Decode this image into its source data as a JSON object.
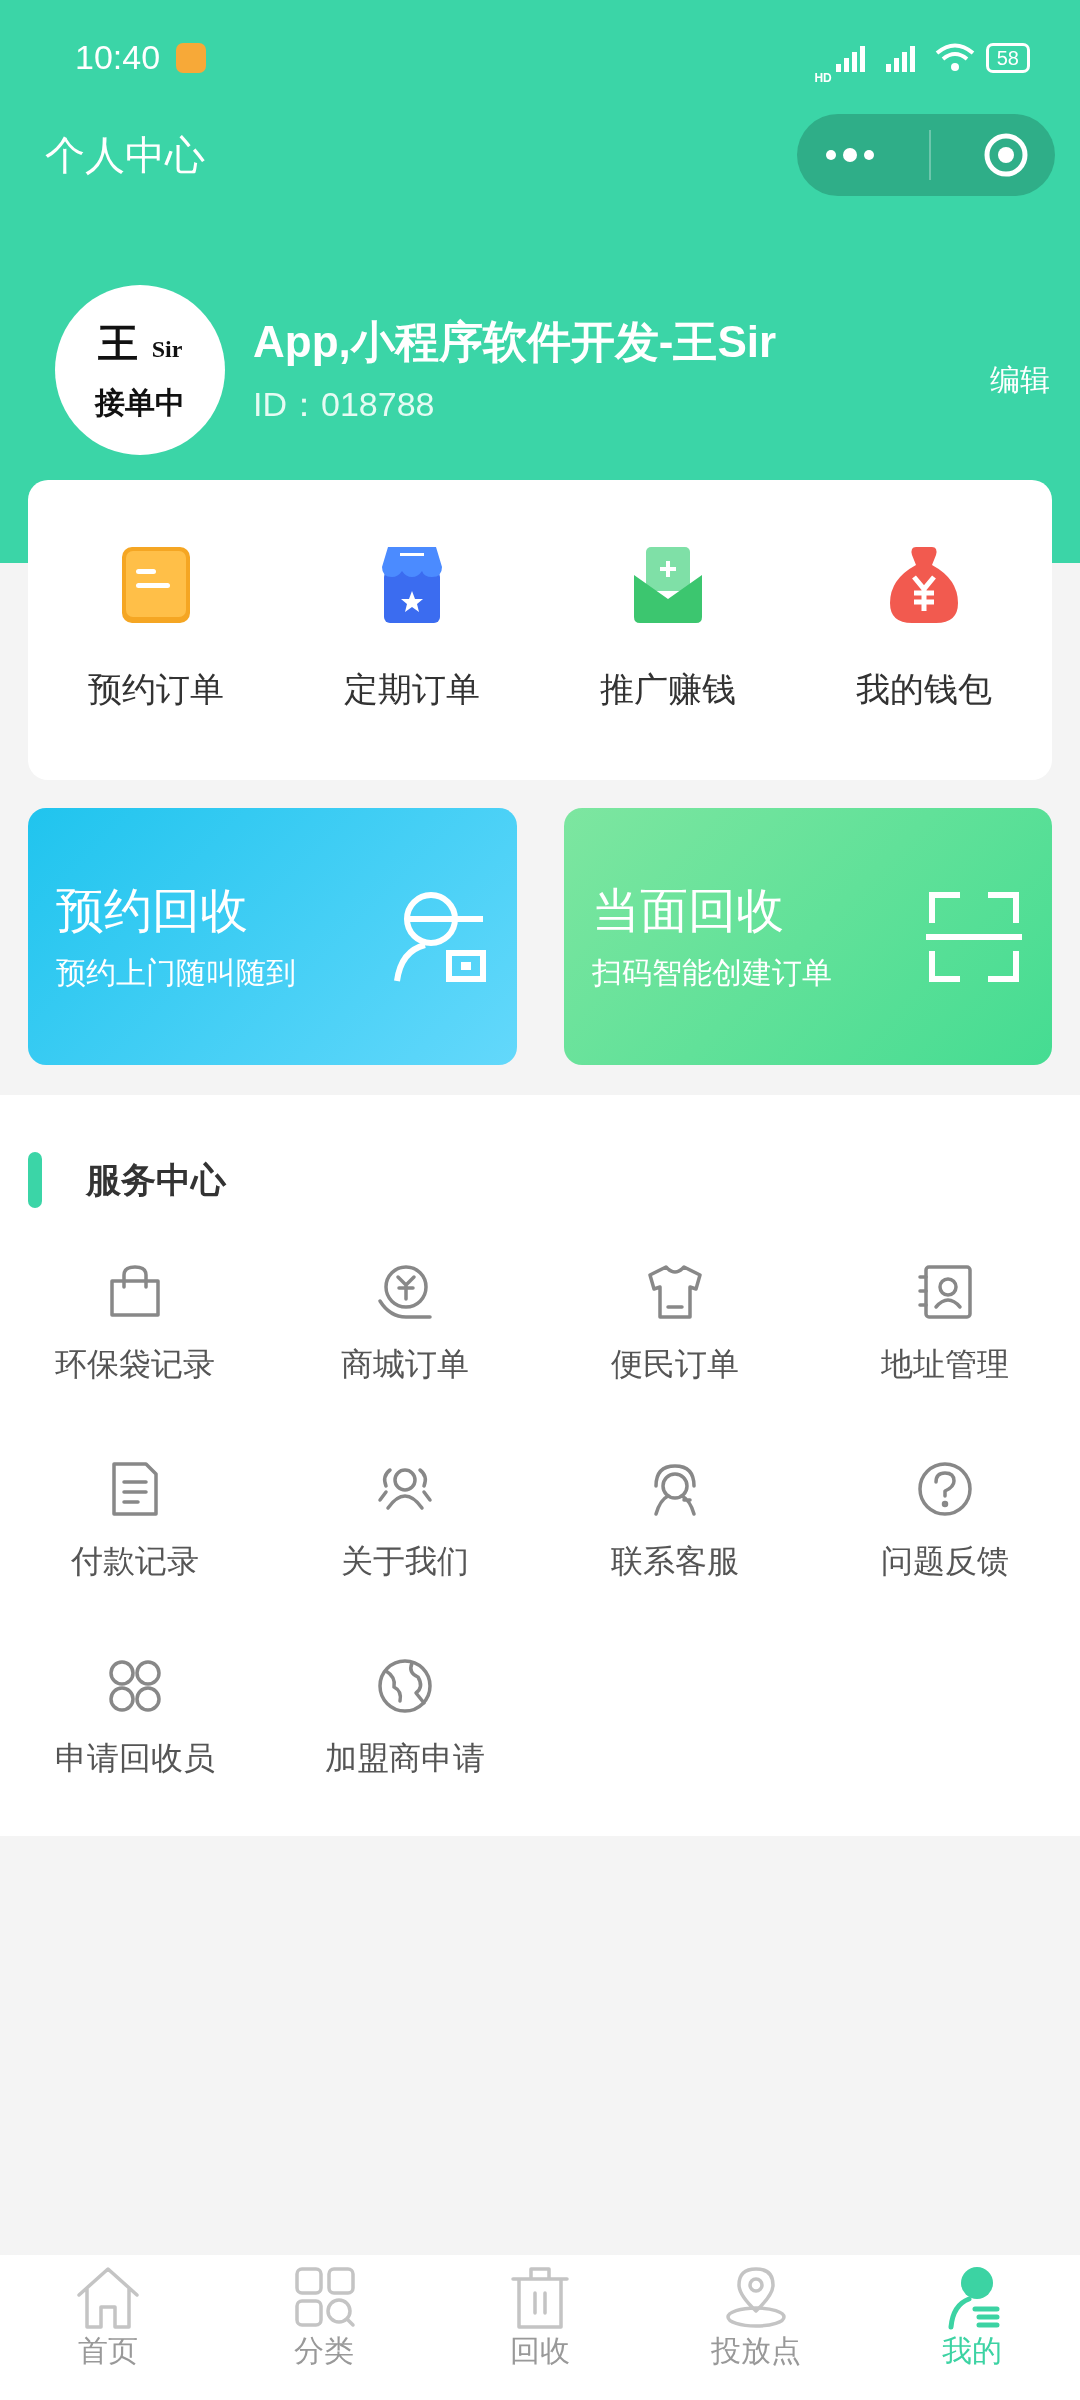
{
  "status_bar": {
    "time": "10:40",
    "network_label": "HD",
    "battery": "58"
  },
  "header": {
    "title": "个人中心"
  },
  "profile": {
    "avatar": {
      "glyph": "王",
      "text": "Sir",
      "status": "接单中"
    },
    "name": "App,小程序软件开发-王Sir",
    "id": "ID：018788",
    "edit": "编辑"
  },
  "quick_actions": [
    {
      "label": "预约订单"
    },
    {
      "label": "定期订单"
    },
    {
      "label": "推广赚钱"
    },
    {
      "label": "我的钱包"
    }
  ],
  "recycle_cards": [
    {
      "title": "预约回收",
      "subtitle": "预约上门随叫随到"
    },
    {
      "title": "当面回收",
      "subtitle": "扫码智能创建订单"
    }
  ],
  "service_center": {
    "title": "服务中心",
    "items": [
      {
        "label": "环保袋记录"
      },
      {
        "label": "商城订单"
      },
      {
        "label": "便民订单"
      },
      {
        "label": "地址管理"
      },
      {
        "label": "付款记录"
      },
      {
        "label": "关于我们"
      },
      {
        "label": "联系客服"
      },
      {
        "label": "问题反馈"
      },
      {
        "label": "申请回收员"
      },
      {
        "label": "加盟商申请"
      }
    ]
  },
  "tab_bar": [
    {
      "label": "首页",
      "selected": false
    },
    {
      "label": "分类",
      "selected": false
    },
    {
      "label": "回收",
      "selected": false
    },
    {
      "label": "投放点",
      "selected": false
    },
    {
      "label": "我的",
      "selected": true
    }
  ]
}
